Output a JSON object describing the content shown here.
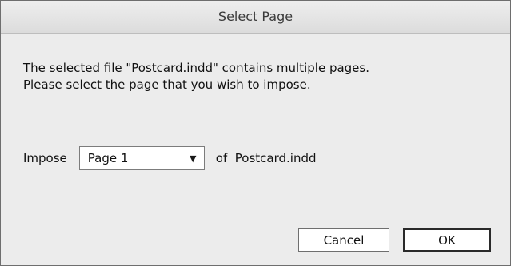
{
  "dialog": {
    "title": "Select Page",
    "message_line1": "The selected file \"Postcard.indd\" contains multiple pages.",
    "message_line2": "Please select the page that you wish to impose."
  },
  "impose": {
    "label": "Impose",
    "selected_page": "Page 1",
    "arrow": "▼",
    "of_text": "of  Postcard.indd"
  },
  "buttons": {
    "cancel": "Cancel",
    "ok": "OK"
  }
}
